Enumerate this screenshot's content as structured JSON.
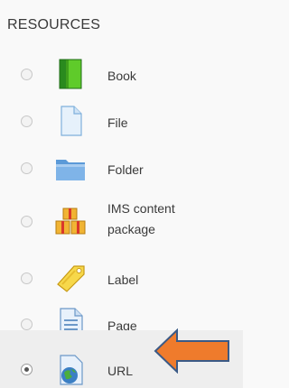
{
  "section": {
    "heading": "RESOURCES"
  },
  "items": [
    {
      "label": "Book",
      "icon": "book-icon",
      "selected": false
    },
    {
      "label": "File",
      "icon": "file-icon",
      "selected": false
    },
    {
      "label": "Folder",
      "icon": "folder-icon",
      "selected": false
    },
    {
      "label_line1": "IMS content",
      "label_line2": "package",
      "icon": "ims-package-icon",
      "selected": false
    },
    {
      "label": "Label",
      "icon": "label-tag-icon",
      "selected": false
    },
    {
      "label": "Page",
      "icon": "page-icon",
      "selected": false
    },
    {
      "label": "URL",
      "icon": "url-globe-icon",
      "selected": true
    }
  ],
  "colors": {
    "panel_bg": "#f9f9f9",
    "selected_bg": "#eeeeee",
    "arrow_fill": "#ef7b2c",
    "arrow_stroke": "#3b5a86"
  }
}
